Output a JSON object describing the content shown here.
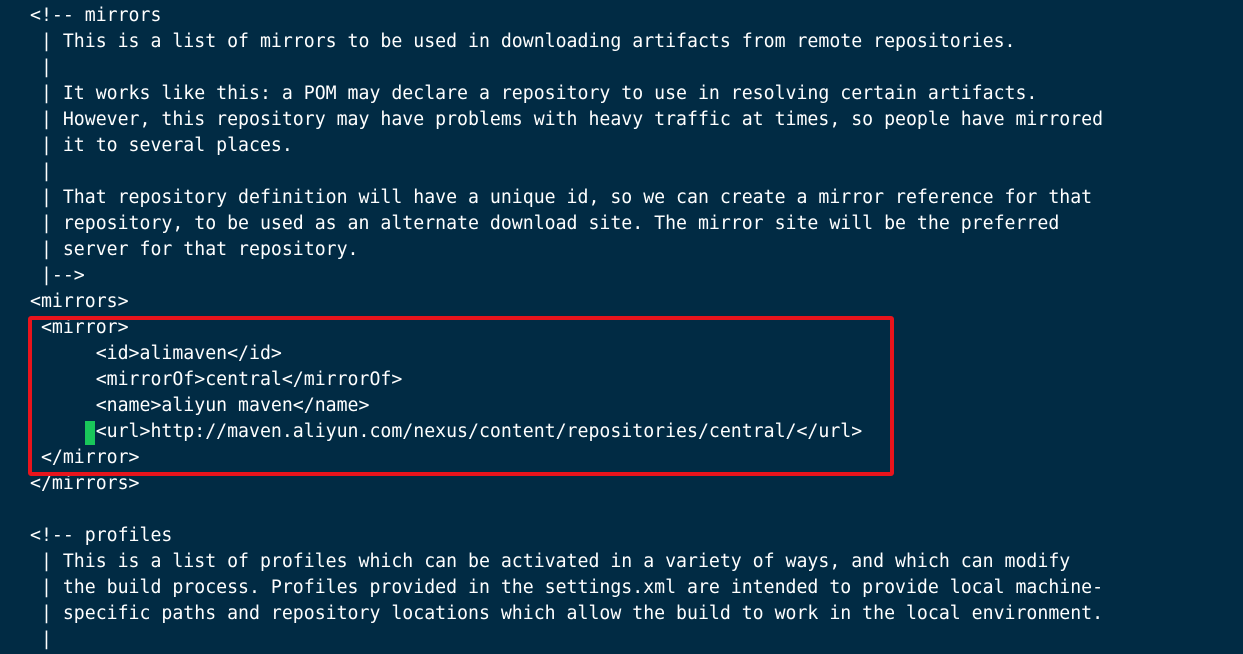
{
  "editor": {
    "lines": [
      "<!-- mirrors",
      " | This is a list of mirrors to be used in downloading artifacts from remote repositories.",
      " |",
      " | It works like this: a POM may declare a repository to use in resolving certain artifacts.",
      " | However, this repository may have problems with heavy traffic at times, so people have mirrored",
      " | it to several places.",
      " |",
      " | That repository definition will have a unique id, so we can create a mirror reference for that",
      " | repository, to be used as an alternate download site. The mirror site will be the preferred",
      " | server for that repository.",
      " |-->",
      "<mirrors>",
      " <mirror>",
      "      <id>alimaven</id>",
      "      <mirrorOf>central</mirrorOf>",
      "      <name>aliyun maven</name>",
      "      <url>http://maven.aliyun.com/nexus/content/repositories/central/</url>",
      " </mirror>",
      "</mirrors>",
      "",
      "<!-- profiles",
      " | This is a list of profiles which can be activated in a variety of ways, and which can modify",
      " | the build process. Profiles provided in the settings.xml are intended to provide local machine-",
      " | specific paths and repository locations which allow the build to work in the local environment.",
      " |"
    ]
  },
  "colors": {
    "background": "#012b44",
    "text": "#ffffff",
    "cursor": "#19c75a",
    "highlight_border": "#e8141c"
  }
}
